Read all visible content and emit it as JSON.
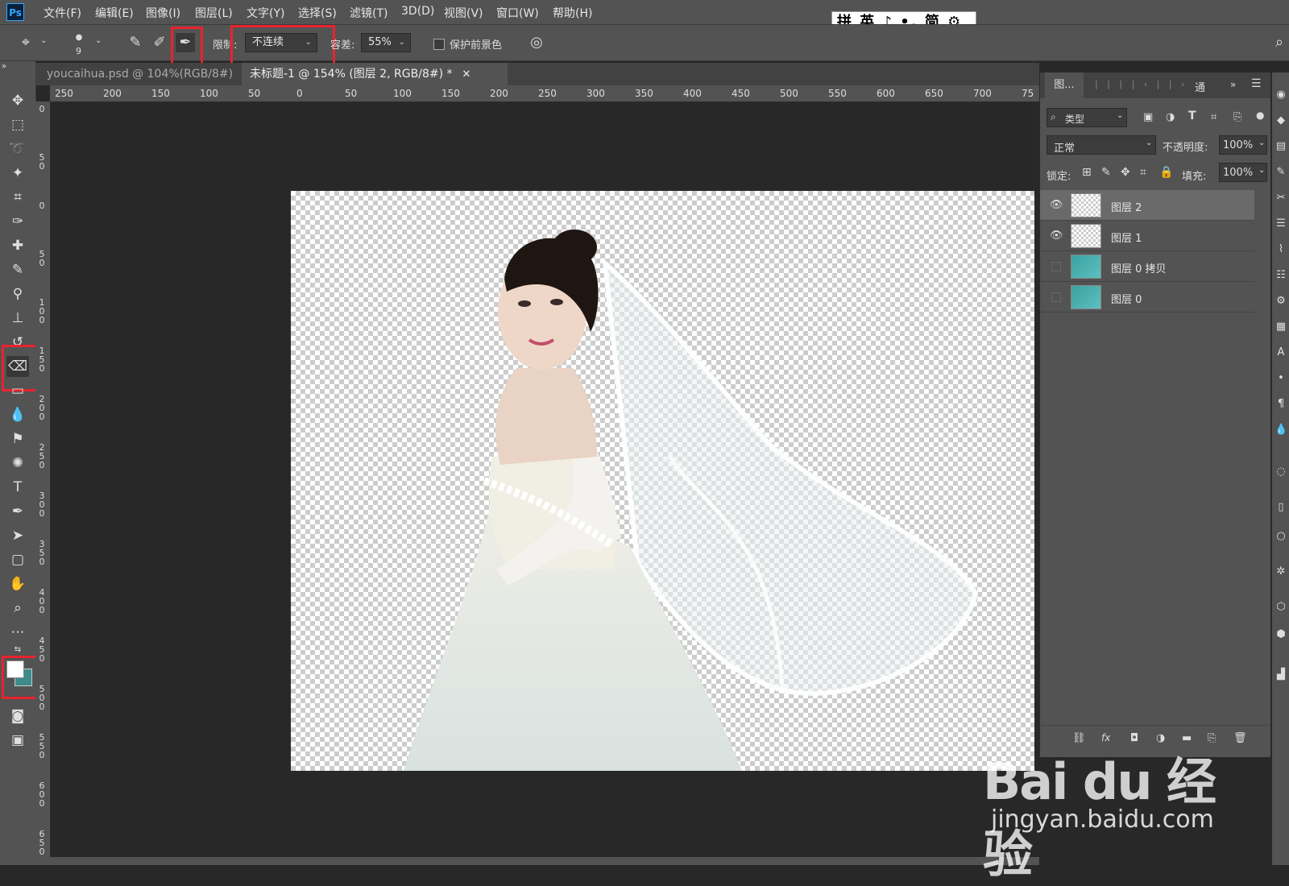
{
  "app": {
    "logo": "Ps"
  },
  "menu": [
    "文件(F)",
    "编辑(E)",
    "图像(I)",
    "图层(L)",
    "文字(Y)",
    "选择(S)",
    "滤镜(T)",
    "3D(D)",
    "视图(V)",
    "窗口(W)",
    "帮助(H)"
  ],
  "ime_bar": {
    "text": "拼 英 ♪ •, 简 ⚙ ⁝"
  },
  "options": {
    "brush_size": "9",
    "limit_label": "限制:",
    "limit_value": "不连续",
    "tolerance_label": "容差:",
    "tolerance_value": "55%",
    "protect_fg_label": "保护前景色"
  },
  "tabs": [
    {
      "label": "youcaihua.psd @ 104%(RGB/8#)",
      "active": false
    },
    {
      "label": "未标题-1 @ 154% (图层 2, RGB/8#) *",
      "active": true
    }
  ],
  "rulers": {
    "h": [
      "250",
      "200",
      "150",
      "100",
      "50",
      "0",
      "50",
      "100",
      "150",
      "200",
      "250",
      "300",
      "350",
      "400",
      "450",
      "500",
      "550",
      "600",
      "650",
      "700",
      "75"
    ],
    "v": [
      "0",
      "5 0",
      "0",
      "5 0",
      "1 0 0",
      "1 5 0",
      "2 0 0",
      "2 5 0",
      "3 0 0",
      "3 5 0",
      "4 0 0",
      "4 5 0",
      "5 0 0",
      "5 5 0",
      "6 0 0",
      "6 5 0"
    ]
  },
  "layers_panel": {
    "tab_label": "图...",
    "tab_label_2": "通",
    "filter_label": "类型",
    "blend_mode": "正常",
    "opacity_label": "不透明度:",
    "opacity_value": "100%",
    "lock_label": "锁定:",
    "fill_label": "填充:",
    "fill_value": "100%",
    "layers": [
      {
        "name": "图层 2",
        "visible": true,
        "selected": true,
        "thumb": "checker"
      },
      {
        "name": "图层 1",
        "visible": true,
        "selected": false,
        "thumb": "checker"
      },
      {
        "name": "图层 0 拷贝",
        "visible": false,
        "selected": false,
        "thumb": "photo"
      },
      {
        "name": "图层 0",
        "visible": false,
        "selected": false,
        "thumb": "photo"
      }
    ]
  },
  "watermark": {
    "logo": "Bai du 经验",
    "url": "jingyan.baidu.com"
  },
  "colors": {
    "foreground": "#ffffff",
    "background": "#3d8b8b",
    "highlight": "#e8232e"
  }
}
